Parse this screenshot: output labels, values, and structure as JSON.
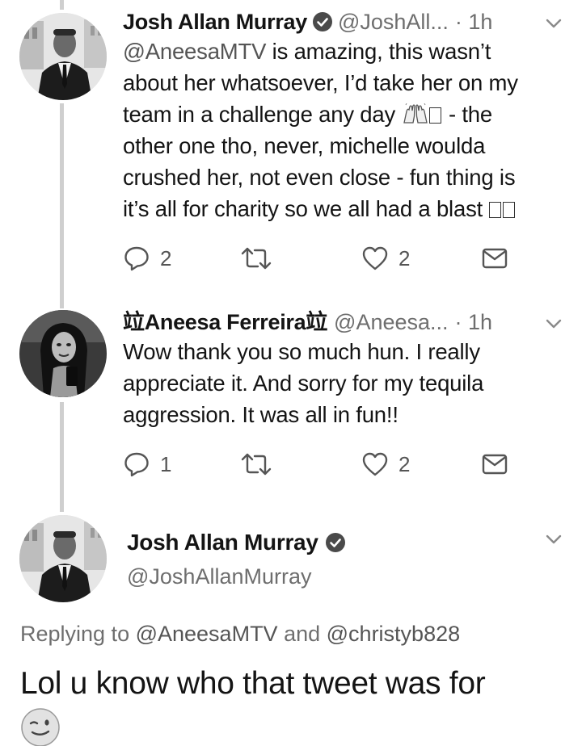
{
  "tweets": [
    {
      "name": "Josh Allan Murray",
      "handle": "@JoshAll...",
      "time": "· 1h",
      "avatar_icon": "man-in-suit-avatar",
      "verified": true,
      "body": {
        "mention": "@AneesaMTV",
        "line1_rest": " is amazing, this wasn’t",
        "line2": "about her whatsoever, I’d take her on my",
        "line3_pre": "team in a challenge any day ",
        "line3_post": " - the",
        "line4": "other one tho, never, michelle woulda",
        "line5": "crushed her, not even close - fun thing is",
        "line6": "it’s all for charity so we all had a blast "
      },
      "replies": "2",
      "likes": "2"
    },
    {
      "name": "竝Aneesa Ferreira竝",
      "handle": "@Aneesa...",
      "time": "· 1h",
      "avatar_icon": "woman-selfie-avatar",
      "verified": false,
      "body": {
        "line1": "Wow thank you so much hun. I really",
        "line2": "appreciate it. And sorry for my tequila",
        "line3": "aggression. It was all in fun!!"
      },
      "replies": "1",
      "likes": "2"
    }
  ],
  "main_tweet": {
    "name": "Josh Allan Murray",
    "handle": "@JoshAllanMurray",
    "replying_prefix": "Replying to ",
    "replying_to_1": "@AneesaMTV",
    "replying_and": " and ",
    "replying_to_2": "@christyb828",
    "text": "Lol u know who that tweet was for",
    "emoji": "wink-emoji"
  },
  "colors": {
    "text": "#141414",
    "secondary": "#6e6e6e",
    "thread_line": "#cfcfcf",
    "icon": "#555555"
  }
}
